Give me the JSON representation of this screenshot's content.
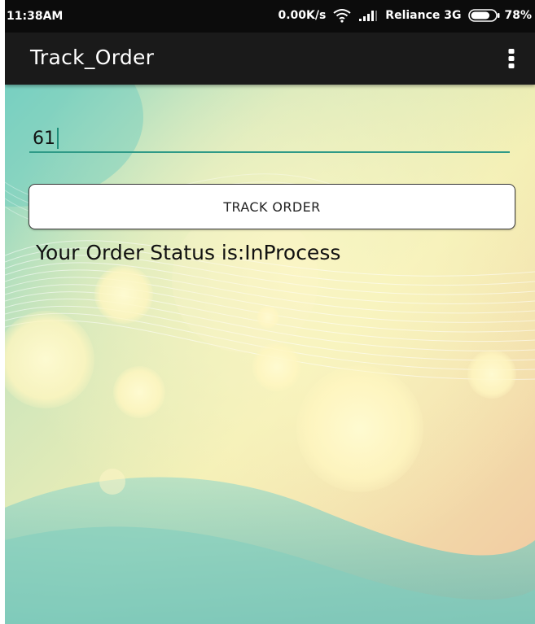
{
  "status_bar": {
    "time": "11:38AM",
    "network_speed": "0.00K/s",
    "carrier": "Reliance 3G",
    "battery": "78%",
    "battery_level": 0.78,
    "icons": [
      "wifi-icon",
      "signal-icon",
      "battery-icon"
    ]
  },
  "action_bar": {
    "title": "Track_Order",
    "menu_icon": "overflow-menu-icon"
  },
  "form": {
    "order_id_value": "61",
    "track_button_label": "TRACK ORDER",
    "status_text": "Your Order Status is:InProcess"
  },
  "colors": {
    "accent": "#2f9a87",
    "action_bar": "#1a1a1a",
    "status_bar": "#0c0c0c"
  }
}
